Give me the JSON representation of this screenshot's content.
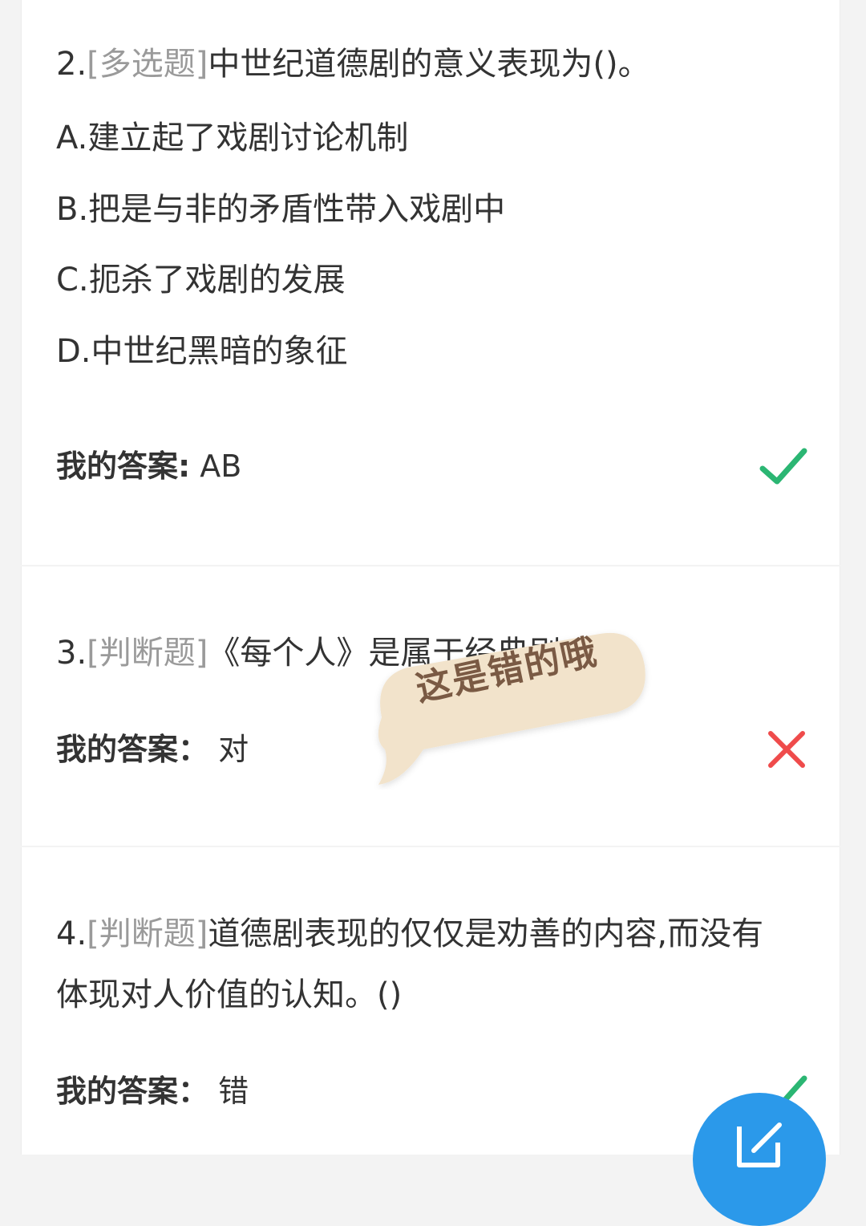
{
  "questions": [
    {
      "number": "2.",
      "type": "[多选题]",
      "text": "中世纪道德剧的意义表现为()。",
      "options": [
        "A.建立起了戏剧讨论机制",
        "B.把是与非的矛盾性带入戏剧中",
        "C.扼杀了戏剧的发展",
        "D.中世纪黑暗的象征"
      ],
      "answer_label": "我的答案:",
      "answer_value": "AB",
      "result": "correct",
      "result_icon": "check-icon"
    },
    {
      "number": "3.",
      "type": "[判断题]",
      "text": "《每个人》是属于经典",
      "text_tail": "剧。()",
      "answer_label": "我的答案：",
      "answer_value": "对",
      "result": "wrong",
      "result_icon": "cross-icon"
    },
    {
      "number": "4.",
      "type": "[判断题]",
      "text": "道德剧表现的仅仅是劝善的内容,而没有体现对人价值的认知。()",
      "answer_label": "我的答案：",
      "answer_value": "错",
      "result": "correct",
      "result_icon": "check-icon"
    }
  ],
  "sticker": {
    "text": "这是错的哦",
    "color": "#f2e3cb"
  },
  "fab": {
    "icon": "edit-icon",
    "color": "#2b99ea"
  },
  "colors": {
    "correct": "#2bb673",
    "wrong": "#ef4b4b",
    "type_tag": "#9a9a9a"
  }
}
